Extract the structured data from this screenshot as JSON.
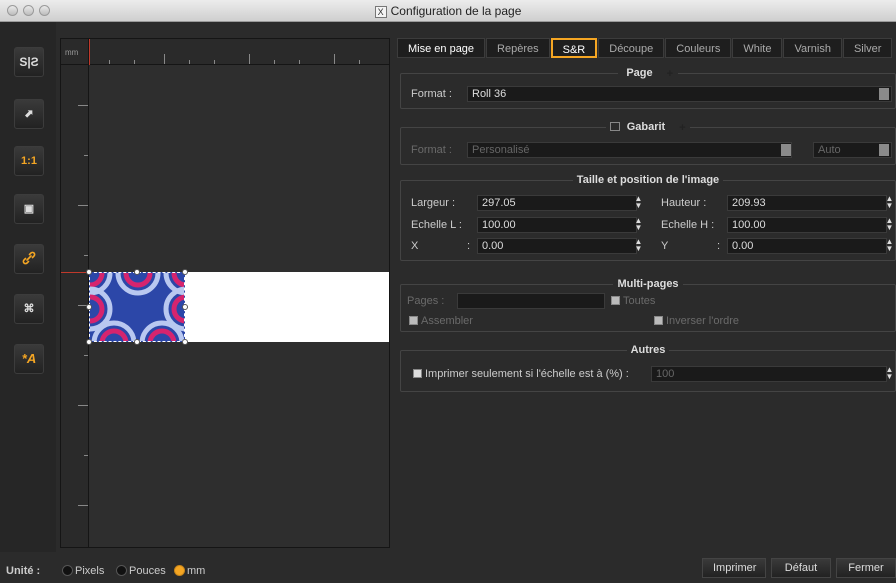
{
  "window": {
    "title": "Configuration de la page",
    "app_icon": "X"
  },
  "toolbar": {
    "tools": [
      {
        "icon": "mirror-icon",
        "glyph": "S|Ƨ"
      },
      {
        "icon": "export-icon",
        "glyph": "⬈"
      },
      {
        "icon": "actual-size-icon",
        "glyph": "1:1"
      },
      {
        "icon": "fit-frame-icon",
        "glyph": "▣"
      },
      {
        "icon": "link-icon",
        "glyph": "🔗"
      },
      {
        "icon": "center-icon",
        "glyph": "⌘"
      },
      {
        "icon": "auto-text-icon",
        "glyph": "*A"
      }
    ]
  },
  "canvas": {
    "ruler_unit": "mm"
  },
  "units": {
    "label": "Unité",
    "options": [
      "Pixels",
      "Pouces",
      "mm"
    ],
    "selected": "mm"
  },
  "tabs": [
    "Mise en page",
    "Repères",
    "S&R",
    "Découpe",
    "Couleurs",
    "White",
    "Varnish",
    "Silver"
  ],
  "active_tab": "Mise en page",
  "highlighted_tab": "S&R",
  "page_group": {
    "title": "Page",
    "format_label": "Format",
    "format_value": "Roll 36"
  },
  "gabarit_group": {
    "title": "Gabarit",
    "format_label": "Format",
    "format_value": "Personalisé",
    "auto_value": "Auto"
  },
  "size_group": {
    "title": "Taille et position de l'image",
    "largeur_label": "Largeur",
    "largeur_value": "297.05",
    "hauteur_label": "Hauteur",
    "hauteur_value": "209.93",
    "echelle_l_label": "Echelle L",
    "echelle_l_value": "100.00",
    "echelle_h_label": "Echelle H",
    "echelle_h_value": "100.00",
    "x_label": "X",
    "x_value": "0.00",
    "y_label": "Y",
    "y_value": "0.00"
  },
  "multipages_group": {
    "title": "Multi-pages",
    "pages_label": "Pages",
    "pages_value": "",
    "toutes_label": "Toutes",
    "assembler_label": "Assembler",
    "inverser_label": "Inverser l'ordre"
  },
  "autres_group": {
    "title": "Autres",
    "print_scale_label": "Imprimer seulement si l'échelle est à (%)",
    "print_scale_value": "100"
  },
  "buttons": {
    "imprimer": "Imprimer",
    "defaut": "Défaut",
    "fermer": "Fermer"
  },
  "colors": {
    "accent": "#f5a623",
    "image_blue": "#2c47a8",
    "image_pink": "#d6246e"
  }
}
